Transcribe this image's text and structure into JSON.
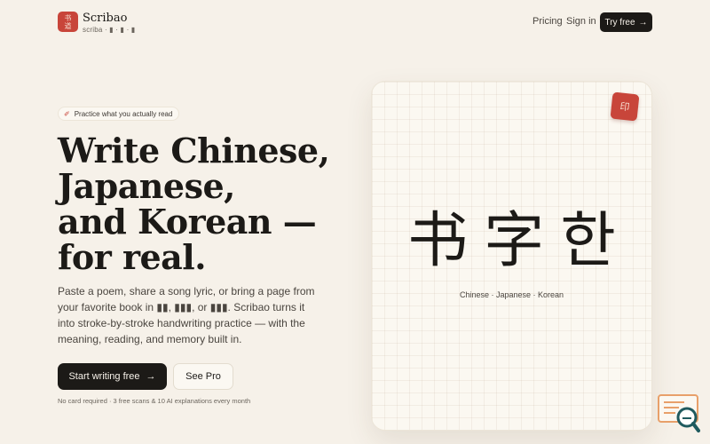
{
  "brand": {
    "name": "Scribao",
    "sub": "scriba · ▮ · ▮ · ▮",
    "mark_glyph_top": "书",
    "mark_glyph_bottom": "道"
  },
  "nav": {
    "pricing": "Pricing",
    "signin": "Sign in",
    "try": "Try free",
    "try_arrow": "→"
  },
  "hero": {
    "pill": "Practice what you actually read",
    "pill_icon": "✐",
    "headline": [
      "Write Chinese,",
      "Japanese,",
      "and Korean —",
      "for real."
    ],
    "description": "Paste a poem, share a song lyric, or bring a page from your favorite book in ▮▮, ▮▮▮, or ▮▮▮. Scribao turns it into stroke-by-stroke handwriting practice — with the meaning, reading, and memory built in.",
    "cta_primary": "Start writing free",
    "cta_primary_arrow": "→",
    "cta_secondary": "See Pro",
    "fineprint": "No card required · 3 free scans & 10 AI explanations every month"
  },
  "card": {
    "seal": "印",
    "glyphs": [
      "书",
      "字",
      "한"
    ],
    "caption": "Chinese · Japanese · Korean"
  },
  "colors": {
    "accent": "#c8453a",
    "background": "#f6f1e9",
    "ink": "#1c1a17"
  }
}
